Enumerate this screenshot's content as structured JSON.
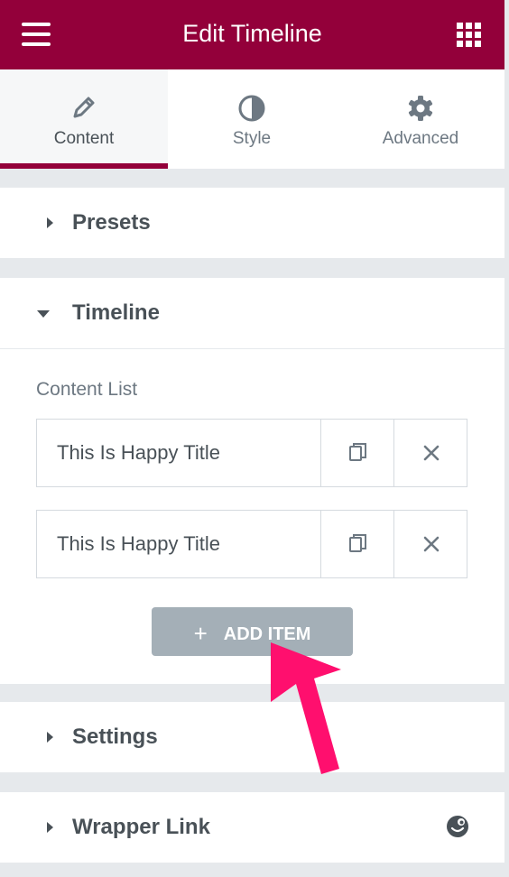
{
  "header": {
    "title": "Edit Timeline"
  },
  "tabs": [
    {
      "label": "Content"
    },
    {
      "label": "Style"
    },
    {
      "label": "Advanced"
    }
  ],
  "sections": {
    "presets": "Presets",
    "timeline": "Timeline",
    "settings": "Settings",
    "wrapper_link": "Wrapper Link"
  },
  "timeline": {
    "content_list_label": "Content List",
    "items": [
      {
        "title": "This Is Happy Title"
      },
      {
        "title": "This Is Happy Title"
      }
    ],
    "add_item_label": "ADD ITEM"
  },
  "colors": {
    "brand": "#93003a",
    "add_button": "#a4afb7",
    "annotation_arrow": "#ff0f6e"
  }
}
